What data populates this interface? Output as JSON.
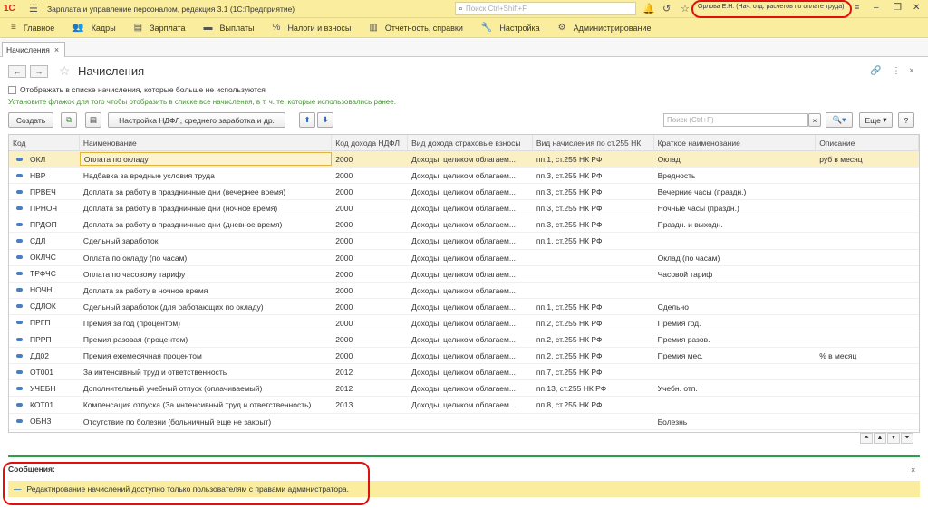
{
  "titlebar": {
    "logo": "1С",
    "app_title": "Зарплата и управление персоналом, редакция 3.1  (1С:Предприятие)",
    "search_placeholder": "Поиск Ctrl+Shift+F",
    "user": "Орлова Е.Н. (Нач. отд. расчетов по оплате труда)"
  },
  "menu": [
    {
      "icon": "≡",
      "label": "Главное"
    },
    {
      "icon": "👥",
      "label": "Кадры"
    },
    {
      "icon": "▤",
      "label": "Зарплата"
    },
    {
      "icon": "▬",
      "label": "Выплаты"
    },
    {
      "icon": "%",
      "label": "Налоги и взносы"
    },
    {
      "icon": "▥",
      "label": "Отчетность, справки"
    },
    {
      "icon": "🔧",
      "label": "Настройка"
    },
    {
      "icon": "⚙",
      "label": "Администрирование"
    }
  ],
  "tab": {
    "label": "Начисления"
  },
  "page": {
    "title": "Начисления",
    "checkbox_label": "Отображать в списке начисления, которые больше не используются",
    "hint": "Установите флажок для того чтобы отобразить в списке все начисления, в т. ч. те, которые использовались ранее."
  },
  "toolbar": {
    "create": "Создать",
    "ndfl_settings": "Настройка НДФЛ, среднего заработка и др.",
    "search_placeholder": "Поиск (Ctrl+F)",
    "more": "Еще"
  },
  "table": {
    "columns": [
      "Код",
      "Наименование",
      "Код дохода НДФЛ",
      "Вид дохода страховые взносы",
      "Вид начисления по ст.255 НК",
      "Краткое наименование",
      "Описание"
    ],
    "rows": [
      [
        "ОКЛ",
        "Оплата по окладу",
        "2000",
        "Доходы, целиком облагаем...",
        "пп.1, ст.255 НК РФ",
        "Оклад",
        "руб в месяц"
      ],
      [
        "НВР",
        "Надбавка за вредные условия труда",
        "2000",
        "Доходы, целиком облагаем...",
        "пп.3, ст.255 НК РФ",
        "Вредность",
        ""
      ],
      [
        "ПРВЕЧ",
        "Доплата за работу в праздничные дни (вечернее время)",
        "2000",
        "Доходы, целиком облагаем...",
        "пп.3, ст.255 НК РФ",
        "Вечерние часы (праздн.)",
        ""
      ],
      [
        "ПРНОЧ",
        "Доплата за работу в праздничные дни (ночное время)",
        "2000",
        "Доходы, целиком облагаем...",
        "пп.3, ст.255 НК РФ",
        "Ночные часы (праздн.)",
        ""
      ],
      [
        "ПРДОП",
        "Доплата за работу в праздничные дни (дневное время)",
        "2000",
        "Доходы, целиком облагаем...",
        "пп.3, ст.255 НК РФ",
        "Праздн. и выходн.",
        ""
      ],
      [
        "СДЛ",
        "Сдельный заработок",
        "2000",
        "Доходы, целиком облагаем...",
        "пп.1, ст.255 НК РФ",
        "",
        ""
      ],
      [
        "ОКЛЧС",
        "Оплата по окладу (по часам)",
        "2000",
        "Доходы, целиком облагаем...",
        "",
        "Оклад (по часам)",
        ""
      ],
      [
        "ТРФЧС",
        "Оплата по часовому тарифу",
        "2000",
        "Доходы, целиком облагаем...",
        "",
        "Часовой тариф",
        ""
      ],
      [
        "НОЧН",
        "Доплата за работу в ночное время",
        "2000",
        "Доходы, целиком облагаем...",
        "",
        "",
        ""
      ],
      [
        "СДЛОК",
        "Сдельный заработок (для работающих по окладу)",
        "2000",
        "Доходы, целиком облагаем...",
        "пп.1, ст.255 НК РФ",
        "Сдельно",
        ""
      ],
      [
        "ПРГП",
        "Премия за год (процентом)",
        "2000",
        "Доходы, целиком облагаем...",
        "пп.2, ст.255 НК РФ",
        "Премия год.",
        ""
      ],
      [
        "ПРРП",
        "Премия разовая (процентом)",
        "2000",
        "Доходы, целиком облагаем...",
        "пп.2, ст.255 НК РФ",
        "Премия разов.",
        ""
      ],
      [
        "ДД02",
        "Премия ежемесячная процентом",
        "2000",
        "Доходы, целиком облагаем...",
        "пп.2, ст.255 НК РФ",
        "Премия мес.",
        "% в месяц"
      ],
      [
        "ОТ001",
        "За интенсивный труд и ответственность",
        "2012",
        "Доходы, целиком облагаем...",
        "пп.7, ст.255 НК РФ",
        "",
        ""
      ],
      [
        "УЧЕБН",
        "Дополнительный учебный отпуск (оплачиваемый)",
        "2012",
        "Доходы, целиком облагаем...",
        "пп.13, ст.255 НК РФ",
        "Учебн. отп.",
        ""
      ],
      [
        "КОТ01",
        "Компенсация отпуска (За интенсивный труд и ответственность)",
        "2013",
        "Доходы, целиком облагаем...",
        "пп.8, ст.255 НК РФ",
        "",
        ""
      ],
      [
        "ОБНЗ",
        "Отсутствие по болезни (больничный еще не закрыт)",
        "",
        "",
        "",
        "Болезнь",
        ""
      ]
    ]
  },
  "messages": {
    "title": "Сообщения:",
    "text": "Редактирование начислений доступно только пользователям с правами администратора."
  }
}
